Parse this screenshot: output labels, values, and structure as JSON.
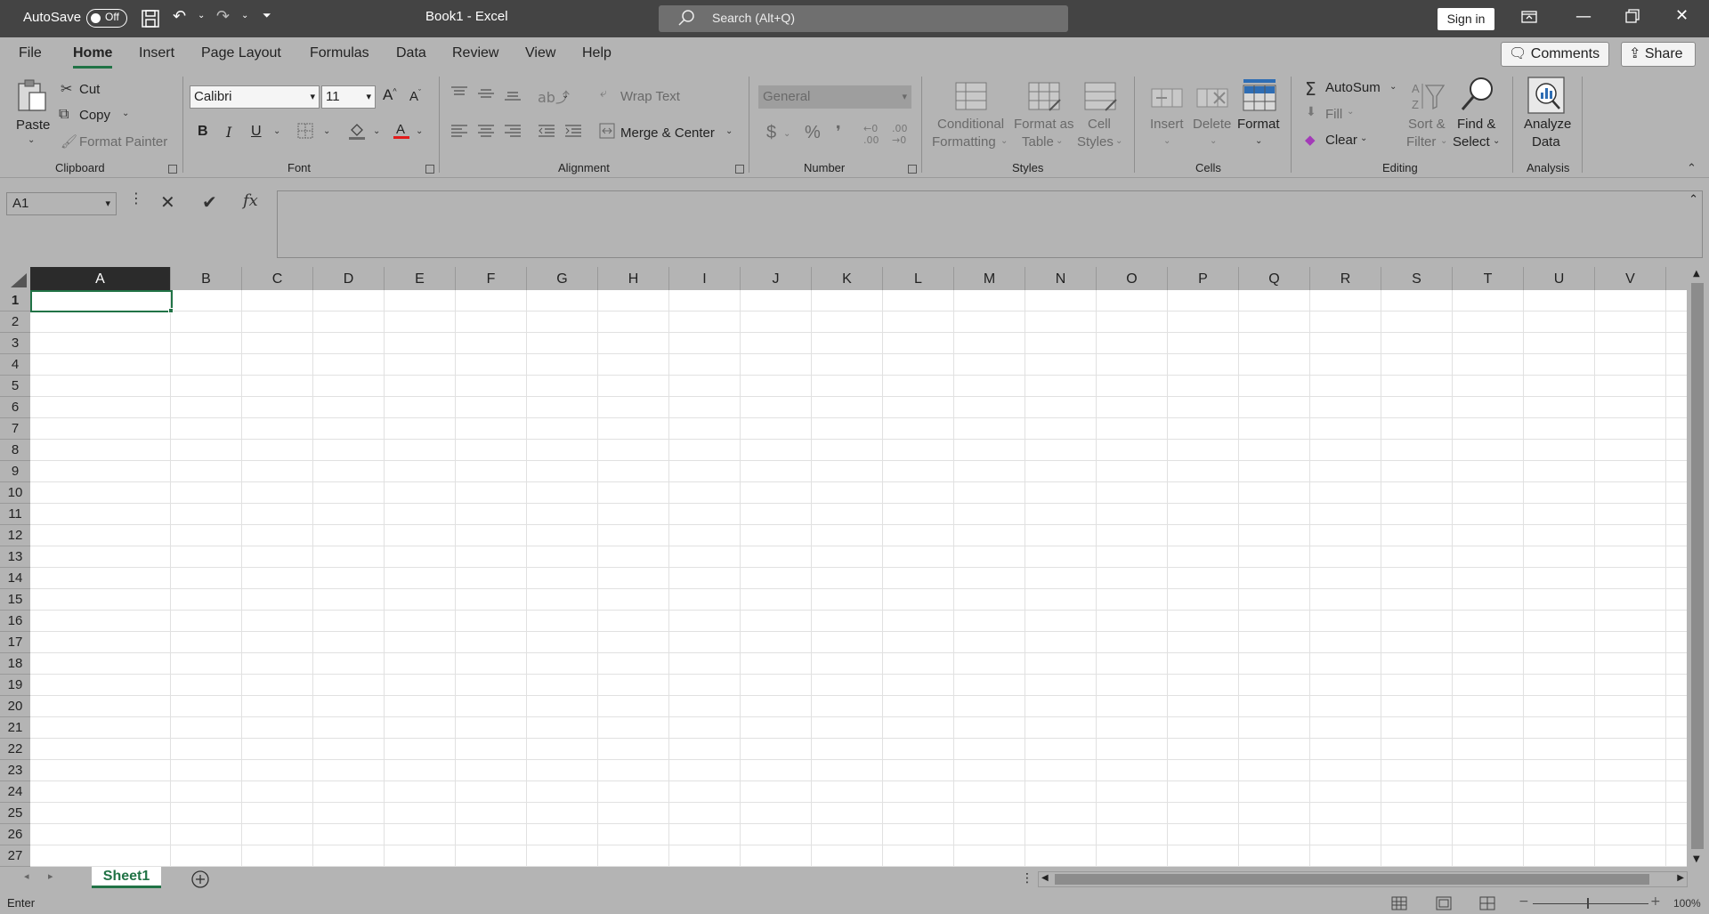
{
  "titlebar": {
    "autosave_label": "AutoSave",
    "autosave_state": "Off",
    "window_title": "Book1  -  Excel",
    "search_placeholder": "Search (Alt+Q)",
    "sign_in": "Sign in"
  },
  "menu": {
    "tabs": [
      "File",
      "Home",
      "Insert",
      "Page Layout",
      "Formulas",
      "Data",
      "Review",
      "View",
      "Help"
    ],
    "active_tab": "Home",
    "comments": "Comments",
    "share": "Share"
  },
  "ribbon": {
    "clipboard": {
      "paste": "Paste",
      "cut": "Cut",
      "copy": "Copy",
      "format_painter": "Format Painter",
      "group": "Clipboard"
    },
    "font": {
      "name": "Calibri",
      "size": "11",
      "bold": "B",
      "italic": "I",
      "underline": "U",
      "group": "Font"
    },
    "alignment": {
      "wrap_text": "Wrap Text",
      "merge_center": "Merge & Center",
      "group": "Alignment"
    },
    "number": {
      "format": "General",
      "currency": "$",
      "percent": "%",
      "comma": "❜",
      "group": "Number"
    },
    "styles": {
      "conditional_1": "Conditional",
      "conditional_2": "Formatting",
      "format_table_1": "Format as",
      "format_table_2": "Table",
      "cell_styles_1": "Cell",
      "cell_styles_2": "Styles",
      "group": "Styles"
    },
    "cells": {
      "insert": "Insert",
      "delete": "Delete",
      "format": "Format",
      "group": "Cells"
    },
    "editing": {
      "autosum": "AutoSum",
      "fill": "Fill",
      "clear": "Clear",
      "sort_1": "Sort &",
      "sort_2": "Filter",
      "find_1": "Find &",
      "find_2": "Select",
      "group": "Editing"
    },
    "analysis": {
      "analyze_1": "Analyze",
      "analyze_2": "Data",
      "group": "Analysis"
    }
  },
  "formula_bar": {
    "name_box": "A1",
    "fx": "fx",
    "content": ""
  },
  "grid": {
    "columns": [
      "A",
      "B",
      "C",
      "D",
      "E",
      "F",
      "G",
      "H",
      "I",
      "J",
      "K",
      "L",
      "M",
      "N",
      "O",
      "P",
      "Q",
      "R",
      "S",
      "T",
      "U",
      "V"
    ],
    "rows": [
      "1",
      "2",
      "3",
      "4",
      "5",
      "6",
      "7",
      "8",
      "9",
      "10",
      "11",
      "12",
      "13",
      "14",
      "15",
      "16",
      "17",
      "18",
      "19",
      "20",
      "21",
      "22",
      "23",
      "24",
      "25",
      "26",
      "27"
    ],
    "selected_cell": "A1"
  },
  "sheets": {
    "active": "Sheet1"
  },
  "status": {
    "mode": "Enter",
    "zoom": "100%"
  },
  "colors": {
    "accent": "#217346",
    "chrome": "#444444",
    "ribbon_bg": "#b4b4b4"
  }
}
